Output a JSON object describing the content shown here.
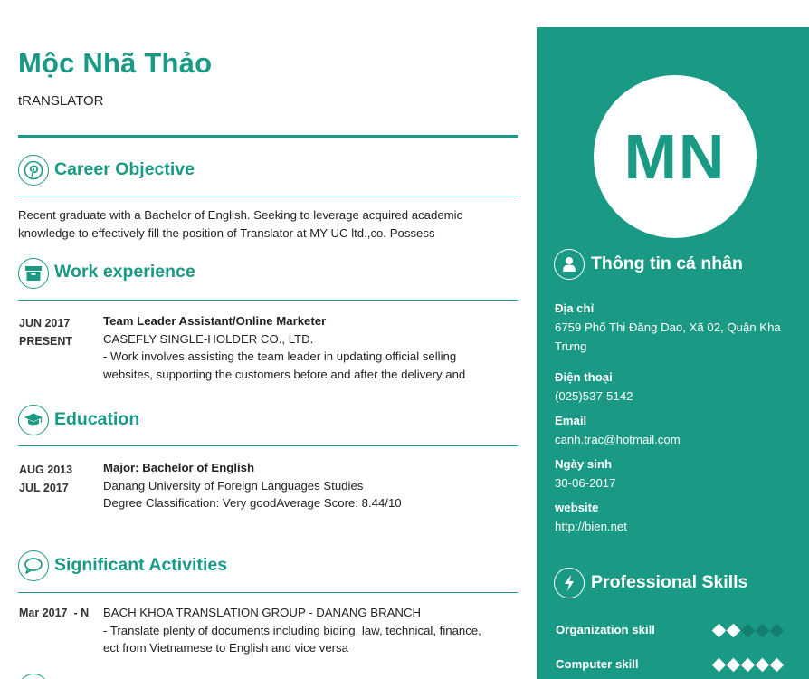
{
  "name": "Mộc Nhã Thảo",
  "title": "tRANSLATOR",
  "initials": "MN",
  "career": {
    "heading": "Career Objective",
    "line1": "Recent graduate with a Bachelor of English. Seeking to leverage acquired academic",
    "line2": "knowledge to effectively fill the position of Translator at MY UC ltd.,co. Possess"
  },
  "work": {
    "heading": "Work experience",
    "date_start": "JUN 2017",
    "date_end": "PRESENT",
    "role": "Team Leader Assistant/Online Marketer",
    "company": "CASEFLY SINGLE-HOLDER CO., LTD.",
    "desc1": "- Work involves assisting the team leader in updating official selling",
    "desc2": "websites, supporting the customers before and after the delivery and"
  },
  "education": {
    "heading": "Education",
    "date_start": "AUG 2013",
    "date_end": "JUL 2017",
    "major": "Major: Bachelor of English",
    "school": "Danang University of Foreign Languages Studies",
    "degree": "Degree Classification: Very goodAverage Score: 8.44/10"
  },
  "activities": {
    "heading": "Significant Activities",
    "date": "Mar 2017  - N",
    "org": "BACH KHOA TRANSLATION GROUP - DANANG BRANCH",
    "desc1": "- Translate plenty of documents including biding, law, technical, finance,",
    "desc2": "ect from Vietnamese to English and vice versa"
  },
  "personal": {
    "heading": "Thông tin cá nhân",
    "address_label": "Địa chỉ",
    "address_line1": "6759 Phố Thi Đăng Dao, Xã 02, Quận Kha",
    "address_line2": "Trưng",
    "phone_label": "Điện thoại",
    "phone": "(025)537-5142",
    "email_label": "Email",
    "email": "canh.trac@hotmail.com",
    "dob_label": "Ngày sinh",
    "dob": "30-06-2017",
    "website_label": "website",
    "website": "http://bien.net"
  },
  "skills": {
    "heading": "Professional Skills",
    "items": [
      {
        "label": "Organization skill",
        "level": 2,
        "max": 5
      },
      {
        "label": "Computer skill",
        "level": 5,
        "max": 5
      }
    ]
  },
  "colors": {
    "accent": "#1a9985",
    "sidebar_text": "#ffffff"
  },
  "icons": [
    "pinterest-icon",
    "archive-icon",
    "graduation-cap-icon",
    "chat-bubble-icon",
    "user-icon",
    "lightning-icon"
  ]
}
